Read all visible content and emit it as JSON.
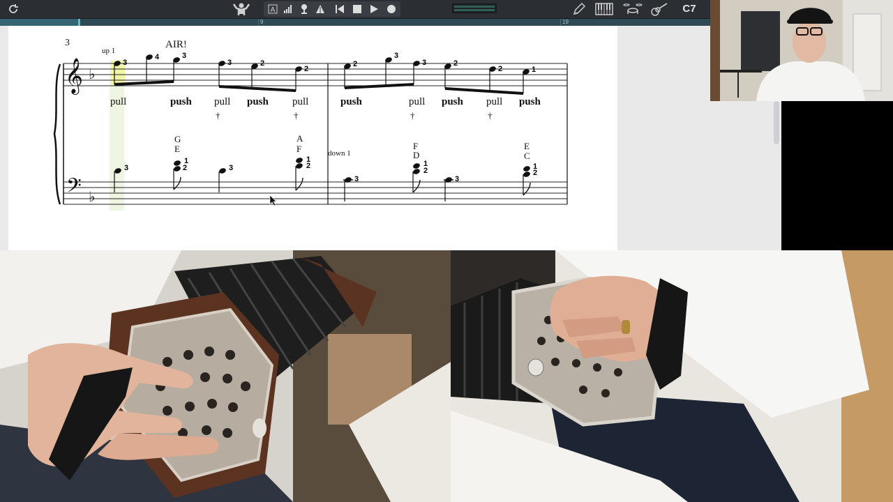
{
  "toolbar": {
    "chord": "C7",
    "icons": [
      "refresh-icon",
      "conductor-icon",
      "text-icon",
      "volume-icon",
      "metronome-icon",
      "tuner-icon",
      "skip-back-icon",
      "stop-icon",
      "play-icon",
      "record-icon",
      "pen-icon",
      "piano-icon",
      "drums-icon",
      "guitar-icon"
    ]
  },
  "timeline": {
    "markers": [
      "9",
      "19"
    ]
  },
  "score": {
    "measure_number": "3",
    "tempo_text": "AIR!",
    "hand_markers": [
      "up 1",
      "down 1"
    ],
    "treble_fingerings": [
      "3",
      "4",
      "3",
      "3",
      "2",
      "2",
      "2",
      "3",
      "3",
      "2",
      "2",
      "1"
    ],
    "bellows": [
      {
        "text": "pull",
        "bold": false
      },
      {
        "text": "push",
        "bold": true
      },
      {
        "text": "pull",
        "bold": false
      },
      {
        "text": "push",
        "bold": true
      },
      {
        "text": "pull",
        "bold": false
      },
      {
        "text": "push",
        "bold": true
      },
      {
        "text": "pull",
        "bold": false
      },
      {
        "text": "push",
        "bold": true
      },
      {
        "text": "pull",
        "bold": false
      },
      {
        "text": "push",
        "bold": true
      }
    ],
    "dagger": "†",
    "chord_names": [
      {
        "top": "G",
        "bottom": "E"
      },
      {
        "top": "A",
        "bottom": "F"
      },
      {
        "top": "F",
        "bottom": "D"
      },
      {
        "top": "E",
        "bottom": "C"
      }
    ],
    "bass_fingerings": [
      "3",
      "1",
      "2",
      "3",
      "1",
      "2",
      "3",
      "1",
      "2",
      "3",
      "1",
      "2"
    ]
  }
}
